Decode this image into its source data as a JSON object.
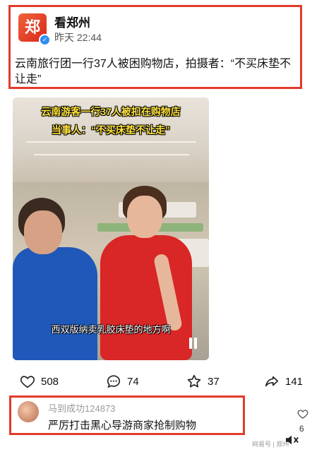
{
  "post": {
    "avatar_char": "郑",
    "author": "看郑州",
    "time": "昨天 22:44",
    "text": "云南旅行团一行37人被困购物店，拍摄者：“不买床垫不让走”"
  },
  "video": {
    "caption_line1": "云南游客一行37人被扣在购物店",
    "caption_line2": "当事人：“不买床垫不让走”",
    "subtitle": "西双版纳卖乳胶床垫的地方啊"
  },
  "actions": {
    "like_count": "508",
    "comment_count": "74",
    "favorite_count": "37",
    "share_count": "141"
  },
  "comment": {
    "username": "马到成功124873",
    "text": "严厉打击黑心导游商家抢制购物",
    "side_count": "6"
  },
  "watermark": "网易号 | 郑州",
  "colors": {
    "highlight_border": "#e33b2b",
    "brand": "#d8261b",
    "verified": "#2e8df3"
  },
  "icons": [
    "heart-icon",
    "comment-icon",
    "star-icon",
    "share-icon",
    "mute-icon",
    "verified-icon",
    "pause-icon"
  ]
}
